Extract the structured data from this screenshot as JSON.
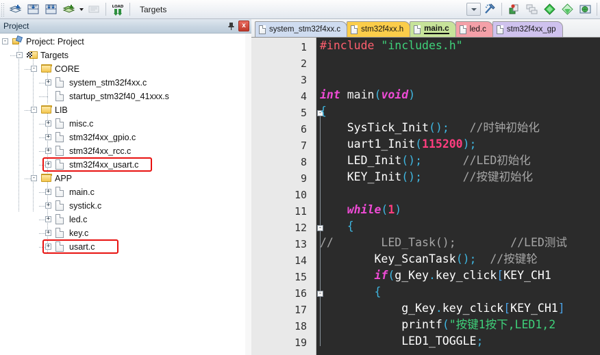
{
  "toolbar": {
    "buttons": [
      {
        "name": "translate-icon",
        "title": "Translate"
      },
      {
        "name": "build-target-icon",
        "title": "Build"
      },
      {
        "name": "rebuild-all-icon",
        "title": "Rebuild All"
      },
      {
        "name": "batch-build-icon",
        "title": "Batch Build"
      },
      {
        "name": "stop-build-icon",
        "title": "Stop Build"
      },
      {
        "name": "download-icon",
        "title": "Download"
      }
    ],
    "load_icon_label": "LOAD",
    "targets_label": "Targets",
    "target_select_value": "Targets",
    "right_buttons": [
      {
        "name": "target-options-icon",
        "title": "Options for Target"
      },
      {
        "name": "manage-project-items-icon",
        "title": "Manage Project Items"
      },
      {
        "name": "multi-project-icon",
        "title": "Multi-Project"
      },
      {
        "name": "diamond-green-icon",
        "title": "Configuration Wizard"
      },
      {
        "name": "diamond-light-icon",
        "title": "Pack Installer"
      },
      {
        "name": "pack-installer-icon",
        "title": "Manage Run-Time Environment"
      }
    ]
  },
  "project_panel": {
    "title": "Project",
    "pin_label": "⚐",
    "close_label": "x",
    "tree": [
      {
        "level": 0,
        "label": "Project: Project",
        "icon": "project-icon",
        "toggle": "-"
      },
      {
        "level": 1,
        "label": "Targets",
        "icon": "targets-icon",
        "toggle": "-"
      },
      {
        "level": 2,
        "label": "CORE",
        "icon": "folder-icon",
        "toggle": "-"
      },
      {
        "level": 3,
        "label": "system_stm32f4xx.c",
        "icon": "file-icon",
        "toggle": "+"
      },
      {
        "level": 3,
        "label": "startup_stm32f40_41xxx.s",
        "icon": "file-icon",
        "toggle": ""
      },
      {
        "level": 2,
        "label": "LIB",
        "icon": "folder-icon",
        "toggle": "-"
      },
      {
        "level": 3,
        "label": "misc.c",
        "icon": "file-icon",
        "toggle": "+"
      },
      {
        "level": 3,
        "label": "stm32f4xx_gpio.c",
        "icon": "file-icon",
        "toggle": "+"
      },
      {
        "level": 3,
        "label": "stm32f4xx_rcc.c",
        "icon": "file-icon",
        "toggle": "+"
      },
      {
        "level": 3,
        "label": "stm32f4xx_usart.c",
        "icon": "file-icon",
        "toggle": "+",
        "highlight": true
      },
      {
        "level": 2,
        "label": "APP",
        "icon": "folder-icon",
        "toggle": "-"
      },
      {
        "level": 3,
        "label": "main.c",
        "icon": "file-icon",
        "toggle": "+"
      },
      {
        "level": 3,
        "label": "systick.c",
        "icon": "file-icon",
        "toggle": "+"
      },
      {
        "level": 3,
        "label": "led.c",
        "icon": "file-icon",
        "toggle": "+"
      },
      {
        "level": 3,
        "label": "key.c",
        "icon": "file-icon",
        "toggle": "+"
      },
      {
        "level": 3,
        "label": "usart.c",
        "icon": "file-icon",
        "toggle": "+",
        "highlight": true
      }
    ],
    "highlight_color": "#e8110f"
  },
  "editor": {
    "tabs": [
      {
        "label": "system_stm32f4xx.c",
        "color": "#cfdcf0",
        "active": false
      },
      {
        "label": "stm32f4xx.h",
        "color": "#fbcd4a",
        "active": false
      },
      {
        "label": "main.c",
        "color": "#c7e39a",
        "active": true
      },
      {
        "label": "led.c",
        "color": "#f4a0a8",
        "active": false
      },
      {
        "label": "stm32f4xx_gp",
        "color": "#cfc2ee",
        "active": false
      }
    ],
    "background": "#2b2b2b",
    "gutter_background": "#e9e9e9",
    "lines": [
      {
        "num": "1",
        "fold": "",
        "segments": [
          {
            "t": "#include ",
            "c": "k-pp"
          },
          {
            "t": "\"includes.h\"",
            "c": "k-str"
          }
        ]
      },
      {
        "num": "2",
        "fold": "",
        "segments": []
      },
      {
        "num": "3",
        "fold": "",
        "segments": []
      },
      {
        "num": "4",
        "fold": "",
        "segments": [
          {
            "t": "int ",
            "c": "k-kw"
          },
          {
            "t": "main",
            "c": "k-fn"
          },
          {
            "t": "(",
            "c": "k-pun"
          },
          {
            "t": "void",
            "c": "k-kw"
          },
          {
            "t": ")",
            "c": "k-pun"
          }
        ]
      },
      {
        "num": "5",
        "fold": "-",
        "segments": [
          {
            "t": "{",
            "c": "k-pun"
          }
        ]
      },
      {
        "num": "6",
        "fold": "",
        "segments": [
          {
            "t": "    SysTick_Init",
            "c": "k-white"
          },
          {
            "t": "();",
            "c": "k-pun"
          },
          {
            "t": "   //时钟初始化",
            "c": "k-cmt"
          }
        ]
      },
      {
        "num": "7",
        "fold": "",
        "segments": [
          {
            "t": "    uart1_Init",
            "c": "k-white"
          },
          {
            "t": "(",
            "c": "k-pun"
          },
          {
            "t": "115200",
            "c": "k-num"
          },
          {
            "t": ");",
            "c": "k-pun"
          }
        ]
      },
      {
        "num": "8",
        "fold": "",
        "segments": [
          {
            "t": "    LED_Init",
            "c": "k-white"
          },
          {
            "t": "();",
            "c": "k-pun"
          },
          {
            "t": "      //LED初始化",
            "c": "k-cmt"
          }
        ]
      },
      {
        "num": "9",
        "fold": "",
        "segments": [
          {
            "t": "    KEY_Init",
            "c": "k-white"
          },
          {
            "t": "();",
            "c": "k-pun"
          },
          {
            "t": "      //按键初始化",
            "c": "k-cmt"
          }
        ]
      },
      {
        "num": "10",
        "fold": "",
        "segments": []
      },
      {
        "num": "11",
        "fold": "",
        "segments": [
          {
            "t": "    while",
            "c": "k-kw"
          },
          {
            "t": "(",
            "c": "k-pun"
          },
          {
            "t": "1",
            "c": "k-num"
          },
          {
            "t": ")",
            "c": "k-pun"
          }
        ]
      },
      {
        "num": "12",
        "fold": "-",
        "segments": [
          {
            "t": "    {",
            "c": "k-pun"
          }
        ]
      },
      {
        "num": "13",
        "fold": "",
        "segments": [
          {
            "t": "//       LED_Task();        //LED测试",
            "c": "k-cmt"
          }
        ]
      },
      {
        "num": "14",
        "fold": "",
        "segments": [
          {
            "t": "        Key_ScanTask",
            "c": "k-white"
          },
          {
            "t": "();",
            "c": "k-pun"
          },
          {
            "t": "  //按键轮",
            "c": "k-cmt"
          }
        ]
      },
      {
        "num": "15",
        "fold": "",
        "segments": [
          {
            "t": "        if",
            "c": "k-kw"
          },
          {
            "t": "(",
            "c": "k-pun"
          },
          {
            "t": "g_Key",
            "c": "k-white"
          },
          {
            "t": ".",
            "c": "k-pun"
          },
          {
            "t": "key_click",
            "c": "k-white"
          },
          {
            "t": "[",
            "c": "k-blue"
          },
          {
            "t": "KEY_CH1",
            "c": "k-white"
          }
        ]
      },
      {
        "num": "16",
        "fold": "-",
        "segments": [
          {
            "t": "        {",
            "c": "k-pun"
          }
        ]
      },
      {
        "num": "17",
        "fold": "",
        "segments": [
          {
            "t": "            g_Key",
            "c": "k-white"
          },
          {
            "t": ".",
            "c": "k-pun"
          },
          {
            "t": "key_click",
            "c": "k-white"
          },
          {
            "t": "[",
            "c": "k-blue"
          },
          {
            "t": "KEY_CH1",
            "c": "k-white"
          },
          {
            "t": "]",
            "c": "k-blue"
          }
        ]
      },
      {
        "num": "18",
        "fold": "",
        "segments": [
          {
            "t": "            printf",
            "c": "k-white"
          },
          {
            "t": "(",
            "c": "k-pun"
          },
          {
            "t": "\"按键1按下,LED1,2",
            "c": "k-str"
          }
        ]
      },
      {
        "num": "19",
        "fold": "",
        "segments": [
          {
            "t": "            LED1_TOGGLE",
            "c": "k-white"
          },
          {
            "t": ";",
            "c": "k-pun"
          }
        ]
      }
    ]
  }
}
